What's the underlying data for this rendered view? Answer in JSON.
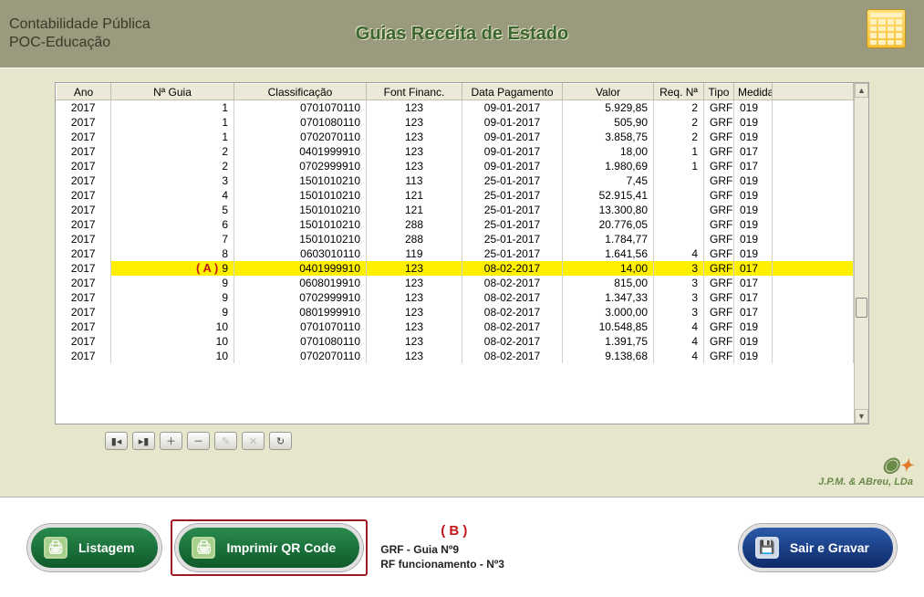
{
  "header": {
    "app_line1": "Contabilidade Pública",
    "app_line2": "POC-Educação",
    "title": "Guias Receita de Estado"
  },
  "columns": {
    "ano": "Ano",
    "guia": "Nª Guia",
    "class": "Classificação",
    "font": "Font Financ.",
    "data": "Data Pagamento",
    "valor": "Valor",
    "req": "Req. Nª",
    "tipo": "Tipo",
    "med": "Medida"
  },
  "rows": [
    {
      "ano": "2017",
      "guia": "1",
      "class": "0701070110",
      "font": "123",
      "data": "09-01-2017",
      "valor": "5.929,85",
      "req": "2",
      "tipo": "GRF",
      "med": "019"
    },
    {
      "ano": "2017",
      "guia": "1",
      "class": "0701080110",
      "font": "123",
      "data": "09-01-2017",
      "valor": "505,90",
      "req": "2",
      "tipo": "GRF",
      "med": "019"
    },
    {
      "ano": "2017",
      "guia": "1",
      "class": "0702070110",
      "font": "123",
      "data": "09-01-2017",
      "valor": "3.858,75",
      "req": "2",
      "tipo": "GRF",
      "med": "019"
    },
    {
      "ano": "2017",
      "guia": "2",
      "class": "0401999910",
      "font": "123",
      "data": "09-01-2017",
      "valor": "18,00",
      "req": "1",
      "tipo": "GRF",
      "med": "017"
    },
    {
      "ano": "2017",
      "guia": "2",
      "class": "0702999910",
      "font": "123",
      "data": "09-01-2017",
      "valor": "1.980,69",
      "req": "1",
      "tipo": "GRF",
      "med": "017"
    },
    {
      "ano": "2017",
      "guia": "3",
      "class": "1501010210",
      "font": "113",
      "data": "25-01-2017",
      "valor": "7,45",
      "req": "",
      "tipo": "GRF",
      "med": "019"
    },
    {
      "ano": "2017",
      "guia": "4",
      "class": "1501010210",
      "font": "121",
      "data": "25-01-2017",
      "valor": "52.915,41",
      "req": "",
      "tipo": "GRF",
      "med": "019"
    },
    {
      "ano": "2017",
      "guia": "5",
      "class": "1501010210",
      "font": "121",
      "data": "25-01-2017",
      "valor": "13.300,80",
      "req": "",
      "tipo": "GRF",
      "med": "019"
    },
    {
      "ano": "2017",
      "guia": "6",
      "class": "1501010210",
      "font": "288",
      "data": "25-01-2017",
      "valor": "20.776,05",
      "req": "",
      "tipo": "GRF",
      "med": "019"
    },
    {
      "ano": "2017",
      "guia": "7",
      "class": "1501010210",
      "font": "288",
      "data": "25-01-2017",
      "valor": "1.784,77",
      "req": "",
      "tipo": "GRF",
      "med": "019"
    },
    {
      "ano": "2017",
      "guia": "8",
      "class": "0603010110",
      "font": "119",
      "data": "25-01-2017",
      "valor": "1.641,56",
      "req": "4",
      "tipo": "GRF",
      "med": "019"
    },
    {
      "ano": "2017",
      "guia": "9",
      "class": "0401999910",
      "font": "123",
      "data": "08-02-2017",
      "valor": "14,00",
      "req": "3",
      "tipo": "GRF",
      "med": "017",
      "selected": true
    },
    {
      "ano": "2017",
      "guia": "9",
      "class": "0608019910",
      "font": "123",
      "data": "08-02-2017",
      "valor": "815,00",
      "req": "3",
      "tipo": "GRF",
      "med": "017"
    },
    {
      "ano": "2017",
      "guia": "9",
      "class": "0702999910",
      "font": "123",
      "data": "08-02-2017",
      "valor": "1.347,33",
      "req": "3",
      "tipo": "GRF",
      "med": "017"
    },
    {
      "ano": "2017",
      "guia": "9",
      "class": "0801999910",
      "font": "123",
      "data": "08-02-2017",
      "valor": "3.000,00",
      "req": "3",
      "tipo": "GRF",
      "med": "017"
    },
    {
      "ano": "2017",
      "guia": "10",
      "class": "0701070110",
      "font": "123",
      "data": "08-02-2017",
      "valor": "10.548,85",
      "req": "4",
      "tipo": "GRF",
      "med": "019"
    },
    {
      "ano": "2017",
      "guia": "10",
      "class": "0701080110",
      "font": "123",
      "data": "08-02-2017",
      "valor": "1.391,75",
      "req": "4",
      "tipo": "GRF",
      "med": "019"
    },
    {
      "ano": "2017",
      "guia": "10",
      "class": "0702070110",
      "font": "123",
      "data": "08-02-2017",
      "valor": "9.138,68",
      "req": "4",
      "tipo": "GRF",
      "med": "019"
    }
  ],
  "annotations": {
    "a": "( A )",
    "b": "( B )"
  },
  "footer": {
    "listagem": "Listagem",
    "imprimir": "Imprimir QR Code",
    "info_line1": "GRF - Guia Nº9",
    "info_line2": "RF funcionamento - Nº3",
    "sair": "Sair e Gravar"
  },
  "brand": "J.P.M. & ABreu, LDa"
}
